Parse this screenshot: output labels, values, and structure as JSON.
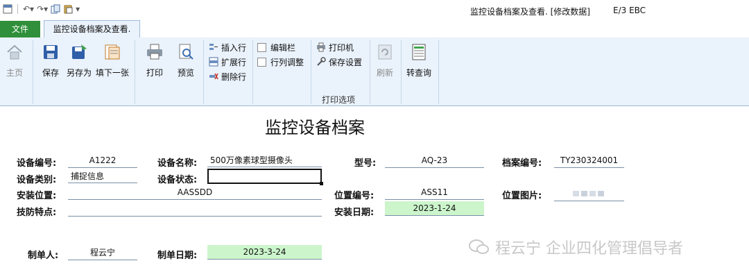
{
  "window": {
    "title": "监控设备档案及查看. [修改数据]",
    "app_label": "E/3 EBC"
  },
  "tabs": {
    "file": "文件",
    "active": "监控设备档案及查看."
  },
  "ribbon": {
    "home": "主页",
    "save": "保存",
    "save_as": "另存为",
    "fill_next": "填下一张",
    "print": "打印",
    "preview": "预览",
    "insert_row": "插入行",
    "expand_row": "扩展行",
    "delete_row": "删除行",
    "edit_bar": "编辑栏",
    "row_col_adjust": "行列调整",
    "printer": "打印机",
    "save_settings": "保存设置",
    "print_options_group": "打印选项",
    "refresh": "刷新",
    "to_query": "转查询"
  },
  "form": {
    "title": "监控设备档案",
    "device_no_label": "设备编号:",
    "device_no": "A1222",
    "device_name_label": "设备名称:",
    "device_name": "500万像素球型摄像头",
    "model_label": "型号:",
    "model": "AQ-23",
    "archive_no_label": "档案编号:",
    "archive_no": "TY230324001",
    "category_label": "设备类别:",
    "category": "捕捉信息",
    "status_label": "设备状态:",
    "status": "",
    "location_label": "安装位置:",
    "location": "AASSDD",
    "location_no_label": "位置编号:",
    "location_no": "ASS11",
    "location_img_label": "位置图片:",
    "features_label": "技防特点:",
    "features": "",
    "install_date_label": "安装日期:",
    "install_date": "2023-1-24",
    "creator_label": "制单人:",
    "creator": "程云宁",
    "create_date_label": "制单日期:",
    "create_date": "2023-3-24"
  },
  "watermark": "程云宁 企业四化管理倡导者"
}
